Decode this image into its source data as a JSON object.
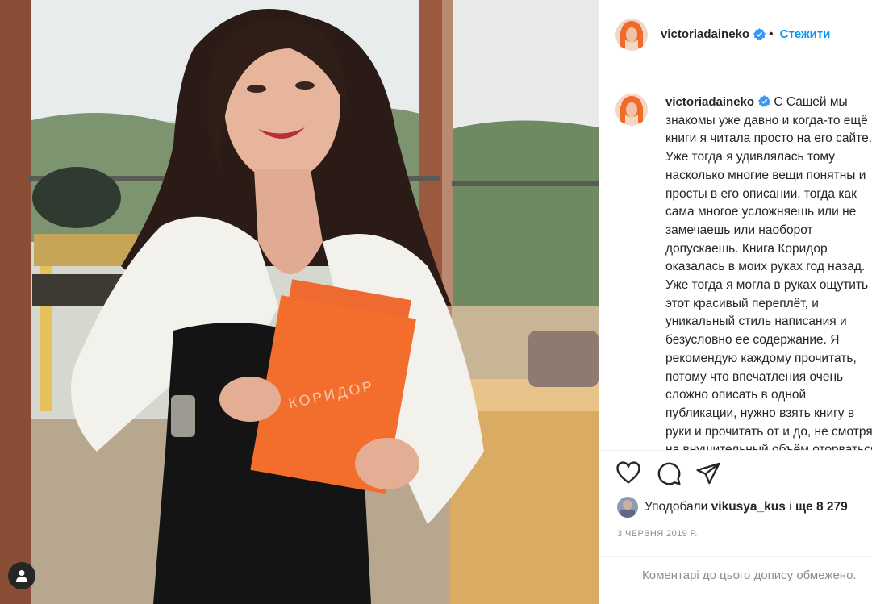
{
  "post": {
    "username": "victoriadaineko",
    "follow_label": "Стежити",
    "caption": "С Сашей мы\nзнакомы уже давно и когда-то ещё\nкниги я читала просто на его сайте.\nУже тогда я удивлялась тому\nнасколько многие вещи понятны и\nпросты в его описании, тогда как\nсама многое усложняешь или не\nзамечаешь или наоборот\nдопускаешь. Книга Коридор\nоказалась в моих руках год назад.\nУже тогда я могла в руках ощутить\nэтот красивый переплёт, и\nуникальный стиль написания и\nбезусловно ее содержание. Я\nрекомендую каждому прочитать,\nпотому что впечатления очень\nсложно описать в одной\nпубликации, нужно взять книгу в\nруки и прочитать от и до, не смотря\nна внушительный объём оторваться",
    "likes_prefix": "Уподобали",
    "likes_user": "vikusya_kus",
    "likes_connector": "і",
    "likes_more": "ще 8 279",
    "date": "3 ЧЕРВНЯ 2019 Р.",
    "comments_disabled": "Коментарі до цього допису обмежено."
  },
  "photo": {
    "book_title": "КОРИДОР"
  },
  "icons": {
    "like": "heart-icon",
    "comment": "comment-icon",
    "share": "paper-plane-icon",
    "verified": "verified-badge-icon",
    "tag": "person-tag-icon"
  },
  "colors": {
    "link": "#0095f6",
    "verified": "#3897f0",
    "text": "#262626",
    "muted": "#8e8e8e",
    "book": "#f26a2e"
  }
}
